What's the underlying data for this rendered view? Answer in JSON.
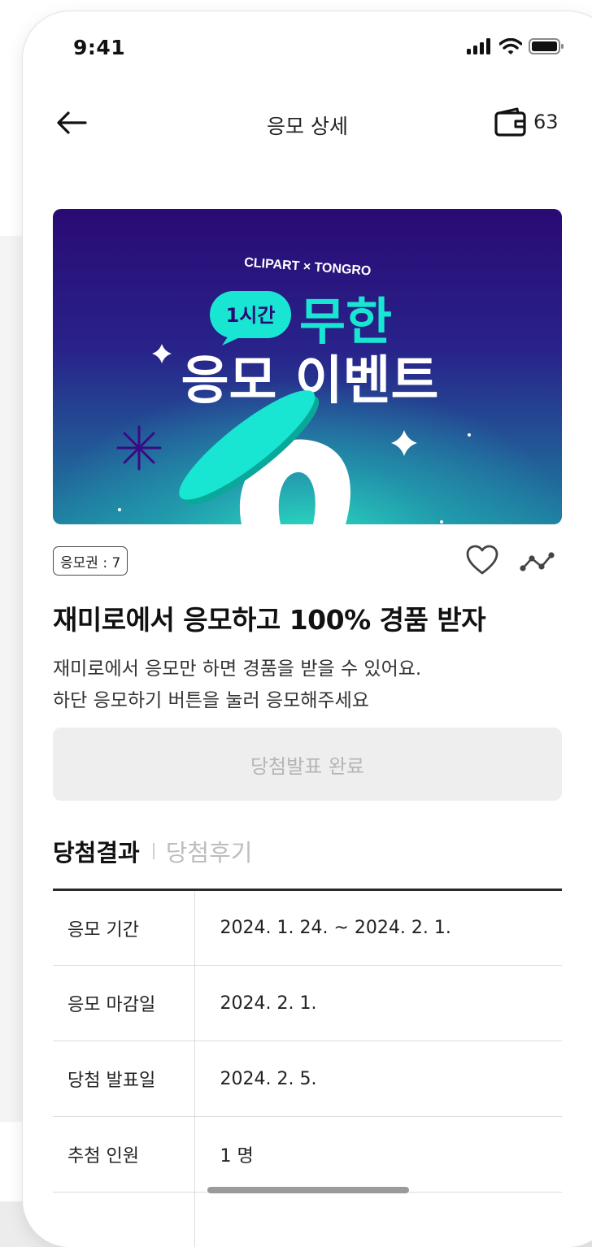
{
  "status_bar": {
    "time": "9:41"
  },
  "header": {
    "title": "응모 상세",
    "wallet_count": "63"
  },
  "banner": {
    "brand": "CLIPART × TONGRO",
    "pill": "1시간",
    "headline_1": "무한",
    "headline_2": "응모 이벤트",
    "colors": {
      "top": "#2a0a74",
      "bottom": "#1e7fa0",
      "accent": "#19e6d2"
    }
  },
  "event": {
    "ticket_badge": "응모권 : 7",
    "title": "재미로에서 응모하고 100% 경품 받자",
    "desc_line1": "재미로에서 응모만 하면 경품을 받을 수 있어요.",
    "desc_line2": "하단 응모하기 버튼을 눌러 응모해주세요",
    "button_label": "당첨발표 완료"
  },
  "tabs": {
    "active": "당첨결과",
    "inactive": "당첨후기"
  },
  "info_rows": [
    {
      "label": "응모 기간",
      "value": "2024. 1. 24. ~ 2024. 2. 1."
    },
    {
      "label": "응모 마감일",
      "value": "2024. 2. 1."
    },
    {
      "label": "당첨 발표일",
      "value": "2024. 2. 5."
    },
    {
      "label": "추첨 인원",
      "value": "1 명"
    }
  ]
}
